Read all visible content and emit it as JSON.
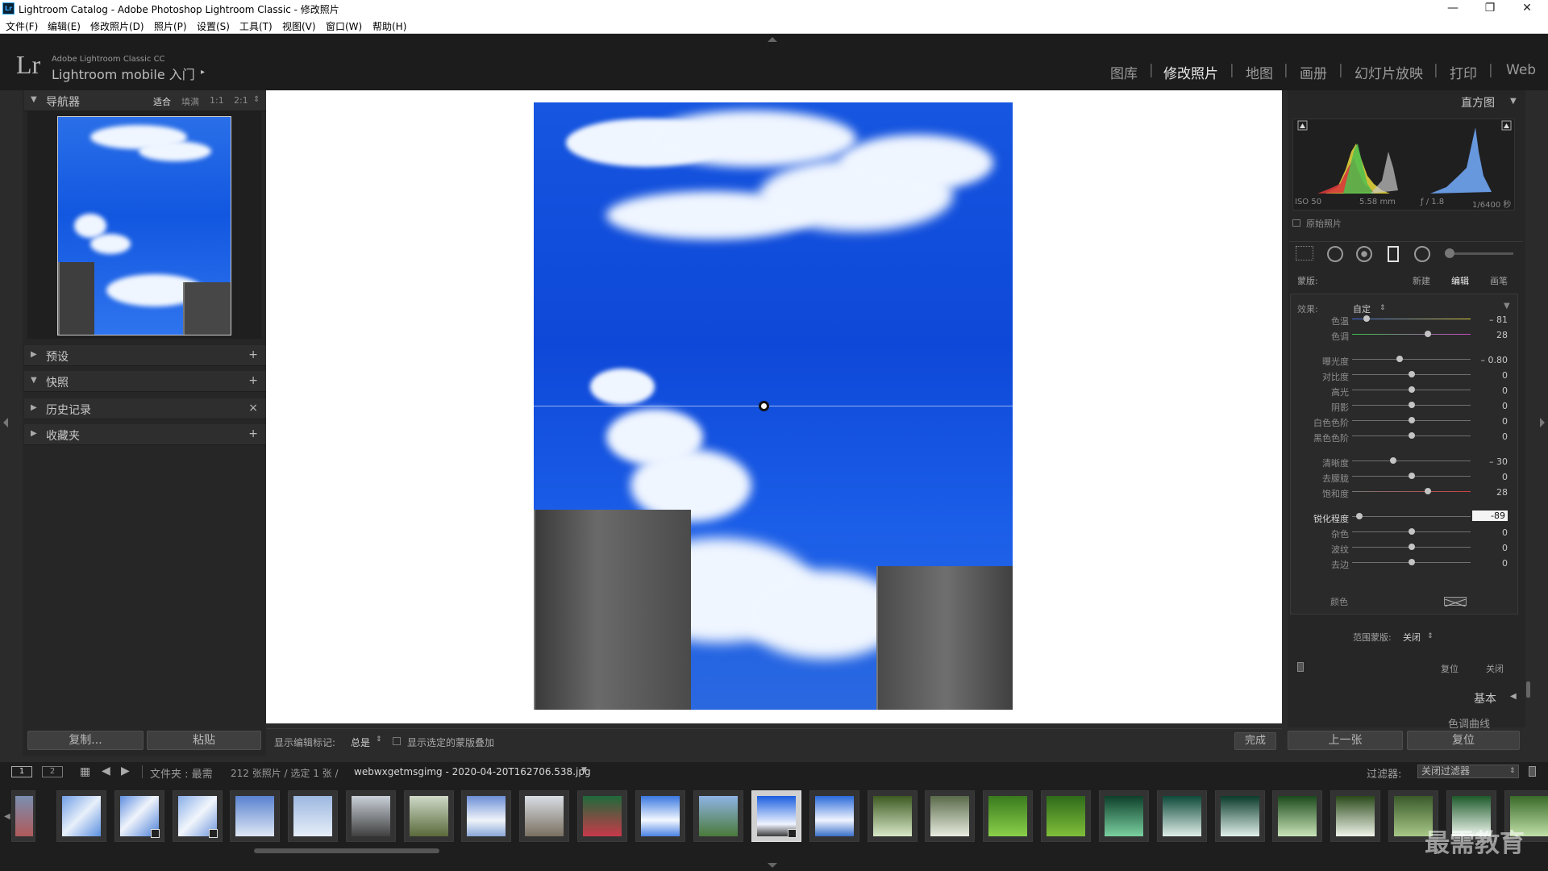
{
  "window": {
    "title": "Lightroom Catalog - Adobe Photoshop Lightroom Classic - 修改照片",
    "logo": "Lr",
    "minimize": "—",
    "restore": "❐",
    "close": "✕"
  },
  "menu": [
    "文件(F)",
    "编辑(E)",
    "修改照片(D)",
    "照片(P)",
    "设置(S)",
    "工具(T)",
    "视图(V)",
    "窗口(W)",
    "帮助(H)"
  ],
  "identity": {
    "logo": "Lr",
    "product": "Adobe Lightroom Classic CC",
    "mobile": "Lightroom mobile 入门",
    "arrow": "▸"
  },
  "modules": [
    "图库",
    "修改照片",
    "地图",
    "画册",
    "幻灯片放映",
    "打印",
    "Web"
  ],
  "active_module": "修改照片",
  "left_panel": {
    "navigator": {
      "title": "导航器",
      "zoom_options": [
        "适合",
        "填满",
        "1:1",
        "2:1"
      ],
      "zoom_active": "适合",
      "stepper": "⇕"
    },
    "sections": [
      {
        "title": "预设",
        "action": "+"
      },
      {
        "title": "快照",
        "action": "+"
      },
      {
        "title": "历史记录",
        "action": "×"
      },
      {
        "title": "收藏夹",
        "action": "+"
      }
    ],
    "copy_button": "复制...",
    "paste_button": "粘贴"
  },
  "toolbar": {
    "show_marks_label": "显示编辑标记:",
    "show_marks_value": "总是",
    "overlay_label": "显示选定的蒙版叠加",
    "done_button": "完成"
  },
  "right_panel": {
    "histogram_title": "直方图",
    "exif": {
      "iso": "ISO 50",
      "focal": "5.58 mm",
      "aperture": "ƒ / 1.8",
      "shutter": "1/6400 秒"
    },
    "original_photo": "原始照片",
    "mask_label": "蒙版:",
    "mask_modes": [
      "新建",
      "编辑",
      "画笔"
    ],
    "mask_active": "编辑",
    "effect_label": "效果:",
    "effect_value": "自定",
    "sliders": [
      {
        "label": "色温",
        "value": "– 81",
        "pos": 0.12,
        "group": 1
      },
      {
        "label": "色调",
        "value": "28",
        "pos": 0.64,
        "group": 1
      },
      {
        "label": "曝光度",
        "value": "– 0.80",
        "pos": 0.4,
        "group": 2
      },
      {
        "label": "对比度",
        "value": "0",
        "pos": 0.5,
        "group": 2
      },
      {
        "label": "高光",
        "value": "0",
        "pos": 0.5,
        "group": 2
      },
      {
        "label": "阴影",
        "value": "0",
        "pos": 0.5,
        "group": 2
      },
      {
        "label": "白色色阶",
        "value": "0",
        "pos": 0.5,
        "group": 2
      },
      {
        "label": "黑色色阶",
        "value": "0",
        "pos": 0.5,
        "group": 2
      },
      {
        "label": "清晰度",
        "value": "– 30",
        "pos": 0.35,
        "group": 3
      },
      {
        "label": "去朦胧",
        "value": "0",
        "pos": 0.5,
        "group": 3
      },
      {
        "label": "饱和度",
        "value": "28",
        "pos": 0.64,
        "group": 3
      },
      {
        "label": "锐化程度",
        "value": "-89",
        "pos": 0.06,
        "group": 4
      },
      {
        "label": "杂色",
        "value": "0",
        "pos": 0.5,
        "group": 4
      },
      {
        "label": "波纹",
        "value": "0",
        "pos": 0.5,
        "group": 4
      },
      {
        "label": "去边",
        "value": "0",
        "pos": 0.5,
        "group": 4
      }
    ],
    "color_label": "颜色",
    "range_mask_label": "范围蒙版:",
    "range_mask_value": "关闭",
    "reset_label": "复位",
    "close_label": "关闭",
    "basic_title": "基本",
    "tone_curve_title": "色调曲线",
    "prev_button": "上一张",
    "reset_button": "复位"
  },
  "filmbar": {
    "view1": "1",
    "view2": "2",
    "folder_label": "文件夹 : 最需",
    "count_text": "212 张照片 / 选定 1 张 /",
    "filename": "webwxgetmsgimg - 2020-04-20T162706.538.jpg",
    "filter_label": "过滤器:",
    "filter_value": "关闭过滤器"
  },
  "watermark": "最需教育"
}
